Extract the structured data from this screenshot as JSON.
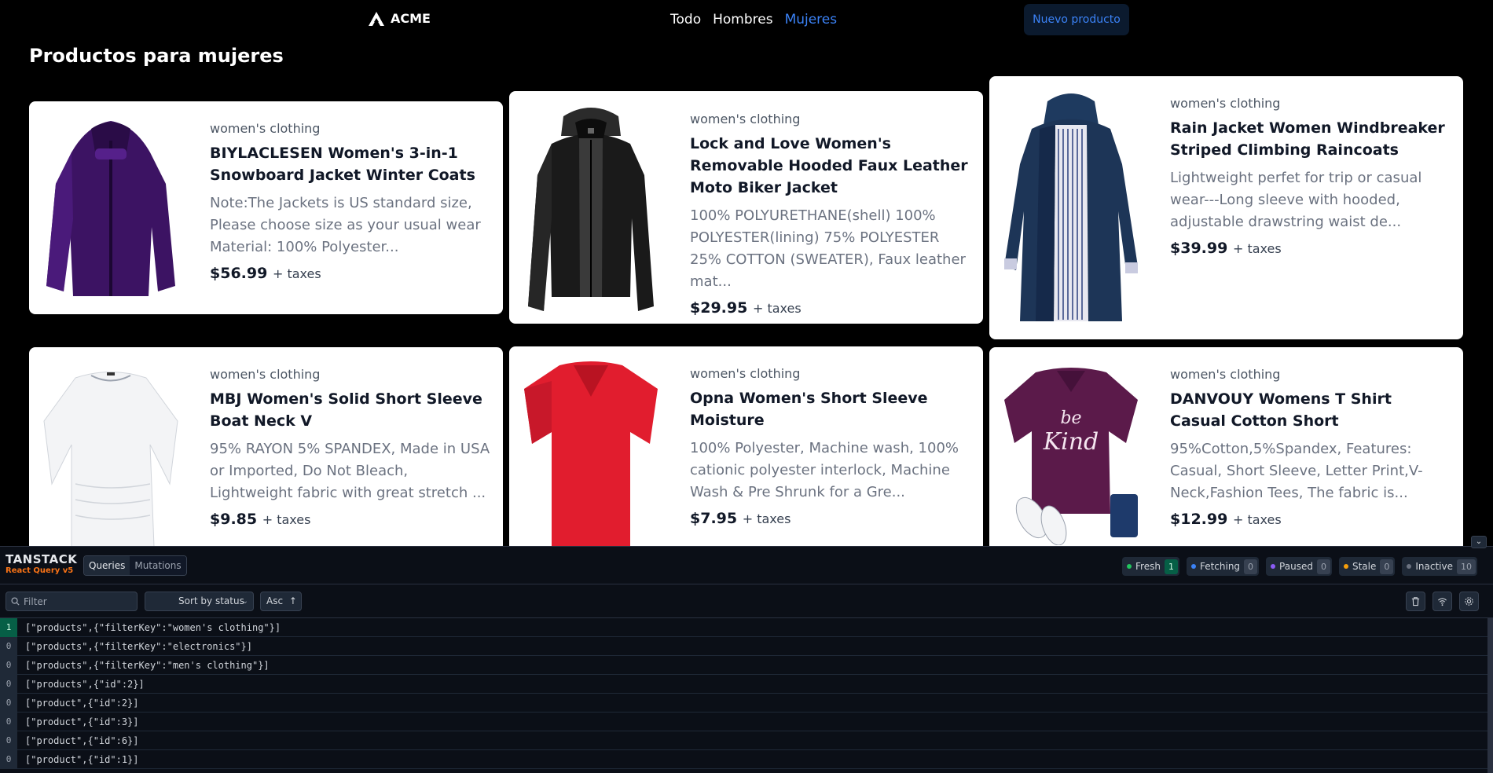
{
  "nav": {
    "brand": "ACME",
    "links": [
      "Todo",
      "Hombres",
      "Mujeres"
    ],
    "active_link": "Mujeres",
    "new_button": "Nuevo producto"
  },
  "page_title": "Productos para mujeres",
  "products": [
    {
      "category": "women's clothing",
      "title": "BIYLACLESEN Women's 3-in-1 Snowboard Jacket Winter Coats",
      "description": "Note:The Jackets is US standard size, Please choose size as your usual wear Material: 100% Polyester...",
      "price": "$56.99",
      "tax": "+ taxes",
      "image": "purple-winter-jacket"
    },
    {
      "category": "women's clothing",
      "title": "Lock and Love Women's Removable Hooded Faux Leather Moto Biker Jacket",
      "description": "100% POLYURETHANE(shell) 100% POLYESTER(lining) 75% POLYESTER 25% COTTON (SWEATER), Faux leather mat...",
      "price": "$29.95",
      "tax": "+ taxes",
      "image": "black-leather-jacket"
    },
    {
      "category": "women's clothing",
      "title": "Rain Jacket Women Windbreaker Striped Climbing Raincoats",
      "description": "Lightweight perfet for trip or casual wear---Long sleeve with hooded, adjustable drawstring waist de...",
      "price": "$39.99",
      "tax": "+ taxes",
      "image": "navy-raincoat"
    },
    {
      "category": "women's clothing",
      "title": "MBJ Women's Solid Short Sleeve Boat Neck V",
      "description": "95% RAYON 5% SPANDEX, Made in USA or Imported, Do Not Bleach, Lightweight fabric with great stretch ...",
      "price": "$9.85",
      "tax": "+ taxes",
      "image": "white-top"
    },
    {
      "category": "women's clothing",
      "title": "Opna Women's Short Sleeve Moisture",
      "description": "100% Polyester, Machine wash, 100% cationic polyester interlock, Machine Wash & Pre Shrunk for a Gre...",
      "price": "$7.95",
      "tax": "+ taxes",
      "image": "red-tshirt"
    },
    {
      "category": "women's clothing",
      "title": "DANVOUY Womens T Shirt Casual Cotton Short",
      "description": "95%Cotton,5%Spandex, Features: Casual, Short Sleeve, Letter Print,V-Neck,Fashion Tees, The fabric is...",
      "price": "$12.99",
      "tax": "+ taxes",
      "image": "purple-tshirt",
      "print_text": [
        "be",
        "Kind"
      ]
    }
  ],
  "devtools": {
    "brand_top": "TANSTACK",
    "brand_bottom": "React Query v5",
    "tabs": [
      "Queries",
      "Mutations"
    ],
    "active_tab": "Queries",
    "status_counts": [
      {
        "label": "Fresh",
        "count": "1",
        "color": "#22c55e"
      },
      {
        "label": "Fetching",
        "count": "0",
        "color": "#3b82f6"
      },
      {
        "label": "Paused",
        "count": "0",
        "color": "#8b5cf6"
      },
      {
        "label": "Stale",
        "count": "0",
        "color": "#f59e0b"
      },
      {
        "label": "Inactive",
        "count": "10",
        "color": "#6b7280"
      }
    ],
    "filter_placeholder": "Filter",
    "sort_label": "Sort by status",
    "order_label": "Asc",
    "queries": [
      {
        "observers": "1",
        "key": "[\"products\",{\"filterKey\":\"women's clothing\"}]",
        "fresh": true
      },
      {
        "observers": "0",
        "key": "[\"products\",{\"filterKey\":\"electronics\"}]",
        "fresh": false
      },
      {
        "observers": "0",
        "key": "[\"products\",{\"filterKey\":\"men's clothing\"}]",
        "fresh": false
      },
      {
        "observers": "0",
        "key": "[\"products\",{\"id\":2}]",
        "fresh": false
      },
      {
        "observers": "0",
        "key": "[\"product\",{\"id\":2}]",
        "fresh": false
      },
      {
        "observers": "0",
        "key": "[\"product\",{\"id\":3}]",
        "fresh": false
      },
      {
        "observers": "0",
        "key": "[\"product\",{\"id\":6}]",
        "fresh": false
      },
      {
        "observers": "0",
        "key": "[\"product\",{\"id\":1}]",
        "fresh": false
      }
    ]
  }
}
